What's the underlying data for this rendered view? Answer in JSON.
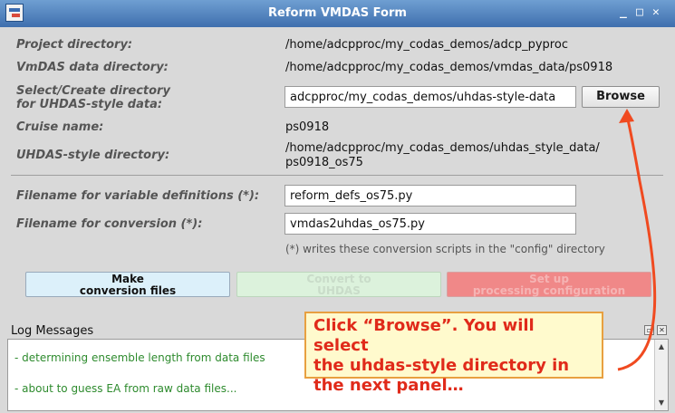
{
  "window": {
    "title": "Reform VMDAS Form",
    "controls": [
      "_",
      "□",
      "✕"
    ]
  },
  "form": {
    "project_dir_label": "Project directory:",
    "project_dir_value": "/home/adcpproc/my_codas_demos/adcp_pyproc",
    "vmdas_dir_label": "VmDAS data directory:",
    "vmdas_dir_value": "/home/adcpproc/my_codas_demos/vmdas_data/ps0918",
    "select_dir_label_1": "Select/Create directory",
    "select_dir_label_2": "for UHDAS-style data:",
    "select_dir_input_value": "adcpproc/my_codas_demos/uhdas-style-data",
    "browse_label": "Browse",
    "cruise_label": "Cruise name:",
    "cruise_value": "ps0918",
    "uhdas_dir_label": "UHDAS-style directory:",
    "uhdas_dir_value_1": "/home/adcpproc/my_codas_demos/uhdas_style_data/",
    "uhdas_dir_value_2": "ps0918_os75",
    "vardefs_label": "Filename for variable definitions (*):",
    "vardefs_value": "reform_defs_os75.py",
    "conversion_label": "Filename for conversion (*):",
    "conversion_value": "vmdas2uhdas_os75.py",
    "note": "(*) writes these conversion scripts in the \"config\" directory"
  },
  "actions": {
    "make_1": "Make",
    "make_2": "conversion files",
    "convert_1": "Convert to",
    "convert_2": "UHDAS",
    "setup_1": "Set up",
    "setup_2": "processing configuration"
  },
  "log": {
    "header": "Log Messages",
    "lines": [
      "- determining ensemble length from data files",
      "- about to guess EA from raw data files..."
    ]
  },
  "callout": {
    "line1": "Click “Browse”.  You will select",
    "line2": "the uhdas-style directory in",
    "line3": "the next panel…"
  },
  "colors": {
    "titlebar": "#4f7fbf",
    "log_text": "#2e8b2e",
    "callout_text": "#e02a1a",
    "arrow": "#f04a20"
  }
}
